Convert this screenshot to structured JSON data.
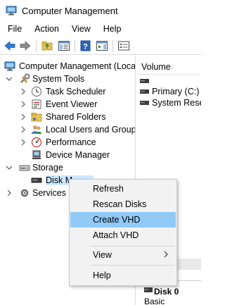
{
  "window": {
    "title": "Computer Management"
  },
  "menubar": {
    "items": [
      "File",
      "Action",
      "View",
      "Help"
    ]
  },
  "toolbar": {
    "buttons": [
      "back-icon",
      "forward-icon",
      "up-folder-icon",
      "show-hide-tree-icon",
      "help-icon",
      "show-hide-action-pane-icon",
      "properties-icon"
    ]
  },
  "tree": {
    "root": "Computer Management (Local",
    "system_tools": "System Tools",
    "task_scheduler": "Task Scheduler",
    "event_viewer": "Event Viewer",
    "shared_folders": "Shared Folders",
    "local_users": "Local Users and Groups",
    "performance": "Performance",
    "device_manager": "Device Manager",
    "storage": "Storage",
    "disk_management": "Disk M",
    "services": "Services an"
  },
  "volume_list": {
    "header": "Volume",
    "rows": [
      "",
      "Primary (C:)",
      "System Reser"
    ]
  },
  "disk_panel": {
    "name": "Disk 0",
    "type": "Basic"
  },
  "context_menu": {
    "refresh": "Refresh",
    "rescan": "Rescan Disks",
    "create_vhd": "Create VHD",
    "attach_vhd": "Attach VHD",
    "view": "View",
    "help": "Help"
  },
  "colors": {
    "highlight": "#91c9f7",
    "menu_bg": "#f2f2f2",
    "selection": "#cce8ff"
  }
}
